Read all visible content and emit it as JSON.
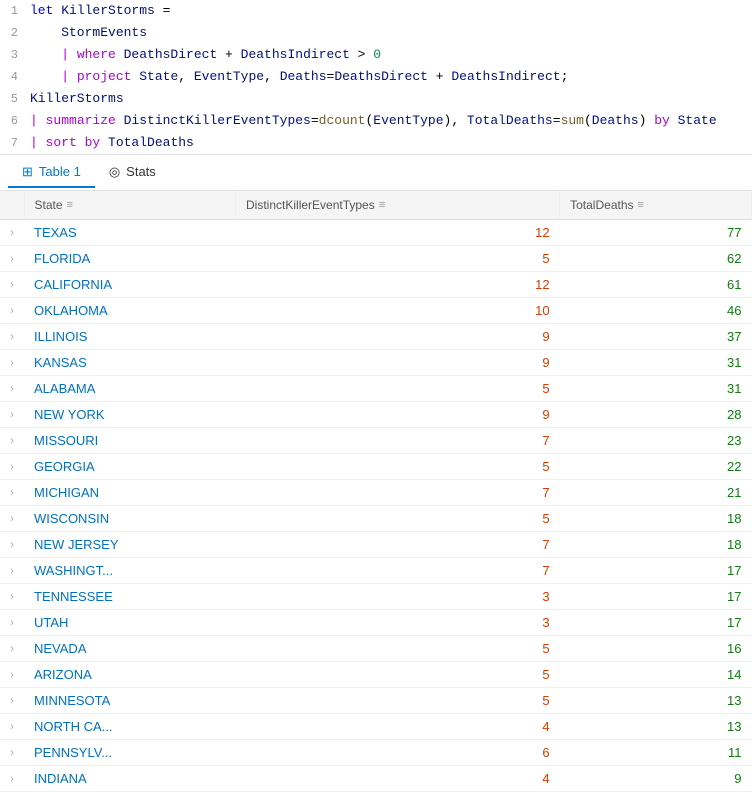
{
  "editor": {
    "lines": [
      {
        "num": 1,
        "tokens": [
          {
            "text": "let ",
            "class": "kw-let"
          },
          {
            "text": "KillerStorms",
            "class": "kw-assign"
          },
          {
            "text": " =",
            "class": "kw-plain"
          }
        ]
      },
      {
        "num": 2,
        "tokens": [
          {
            "text": "    StormEvents",
            "class": "kw-ident"
          }
        ]
      },
      {
        "num": 3,
        "tokens": [
          {
            "text": "    | ",
            "class": "kw-pipe"
          },
          {
            "text": "where ",
            "class": "kw-keyword"
          },
          {
            "text": "DeathsDirect",
            "class": "kw-ident"
          },
          {
            "text": " + ",
            "class": "kw-plain"
          },
          {
            "text": "DeathsIndirect",
            "class": "kw-ident"
          },
          {
            "text": " > ",
            "class": "kw-plain"
          },
          {
            "text": "0",
            "class": "kw-num"
          }
        ]
      },
      {
        "num": 4,
        "tokens": [
          {
            "text": "    | ",
            "class": "kw-pipe"
          },
          {
            "text": "project ",
            "class": "kw-keyword"
          },
          {
            "text": "State",
            "class": "kw-ident"
          },
          {
            "text": ", ",
            "class": "kw-plain"
          },
          {
            "text": "EventType",
            "class": "kw-ident"
          },
          {
            "text": ", ",
            "class": "kw-plain"
          },
          {
            "text": "Deaths",
            "class": "kw-ident"
          },
          {
            "text": "=",
            "class": "kw-plain"
          },
          {
            "text": "DeathsDirect",
            "class": "kw-ident"
          },
          {
            "text": " + ",
            "class": "kw-plain"
          },
          {
            "text": "DeathsIndirect",
            "class": "kw-ident"
          },
          {
            "text": ";",
            "class": "kw-plain"
          }
        ]
      },
      {
        "num": 5,
        "tokens": [
          {
            "text": "KillerStorms",
            "class": "kw-ident"
          }
        ]
      },
      {
        "num": 6,
        "tokens": [
          {
            "text": "| ",
            "class": "kw-pipe"
          },
          {
            "text": "summarize ",
            "class": "kw-keyword"
          },
          {
            "text": "DistinctKillerEventTypes",
            "class": "kw-ident"
          },
          {
            "text": "=",
            "class": "kw-plain"
          },
          {
            "text": "dcount",
            "class": "kw-func"
          },
          {
            "text": "(",
            "class": "kw-plain"
          },
          {
            "text": "EventType",
            "class": "kw-ident"
          },
          {
            "text": "), ",
            "class": "kw-plain"
          },
          {
            "text": "TotalDeaths",
            "class": "kw-ident"
          },
          {
            "text": "=",
            "class": "kw-plain"
          },
          {
            "text": "sum",
            "class": "kw-func"
          },
          {
            "text": "(",
            "class": "kw-plain"
          },
          {
            "text": "Deaths",
            "class": "kw-ident"
          },
          {
            "text": ") ",
            "class": "kw-plain"
          },
          {
            "text": "by ",
            "class": "kw-keyword"
          },
          {
            "text": "State",
            "class": "kw-ident"
          }
        ]
      },
      {
        "num": 7,
        "tokens": [
          {
            "text": "| ",
            "class": "kw-pipe"
          },
          {
            "text": "sort ",
            "class": "kw-keyword"
          },
          {
            "text": "by ",
            "class": "kw-keyword"
          },
          {
            "text": "TotalDeaths",
            "class": "kw-ident"
          }
        ]
      }
    ]
  },
  "tabs": [
    {
      "label": "Table 1",
      "icon": "⊞",
      "active": true
    },
    {
      "label": "Stats",
      "icon": "◎",
      "active": false
    }
  ],
  "table": {
    "columns": [
      {
        "label": "",
        "key": "expand"
      },
      {
        "label": "State",
        "key": "state"
      },
      {
        "label": "DistinctKillerEventTypes",
        "key": "distinct"
      },
      {
        "label": "TotalDeaths",
        "key": "deaths"
      }
    ],
    "rows": [
      {
        "state": "TEXAS",
        "distinct": "12",
        "deaths": "77"
      },
      {
        "state": "FLORIDA",
        "distinct": "5",
        "deaths": "62"
      },
      {
        "state": "CALIFORNIA",
        "distinct": "12",
        "deaths": "61"
      },
      {
        "state": "OKLAHOMA",
        "distinct": "10",
        "deaths": "46"
      },
      {
        "state": "ILLINOIS",
        "distinct": "9",
        "deaths": "37"
      },
      {
        "state": "KANSAS",
        "distinct": "9",
        "deaths": "31"
      },
      {
        "state": "ALABAMA",
        "distinct": "5",
        "deaths": "31"
      },
      {
        "state": "NEW YORK",
        "distinct": "9",
        "deaths": "28"
      },
      {
        "state": "MISSOURI",
        "distinct": "7",
        "deaths": "23"
      },
      {
        "state": "GEORGIA",
        "distinct": "5",
        "deaths": "22"
      },
      {
        "state": "MICHIGAN",
        "distinct": "7",
        "deaths": "21"
      },
      {
        "state": "WISCONSIN",
        "distinct": "5",
        "deaths": "18"
      },
      {
        "state": "NEW JERSEY",
        "distinct": "7",
        "deaths": "18"
      },
      {
        "state": "WASHINGT...",
        "distinct": "7",
        "deaths": "17"
      },
      {
        "state": "TENNESSEE",
        "distinct": "3",
        "deaths": "17"
      },
      {
        "state": "UTAH",
        "distinct": "3",
        "deaths": "17"
      },
      {
        "state": "NEVADA",
        "distinct": "5",
        "deaths": "16"
      },
      {
        "state": "ARIZONA",
        "distinct": "5",
        "deaths": "14"
      },
      {
        "state": "MINNESOTA",
        "distinct": "5",
        "deaths": "13"
      },
      {
        "state": "NORTH CA...",
        "distinct": "4",
        "deaths": "13"
      },
      {
        "state": "PENNSYLV...",
        "distinct": "6",
        "deaths": "11"
      },
      {
        "state": "INDIANA",
        "distinct": "4",
        "deaths": "9"
      }
    ]
  }
}
